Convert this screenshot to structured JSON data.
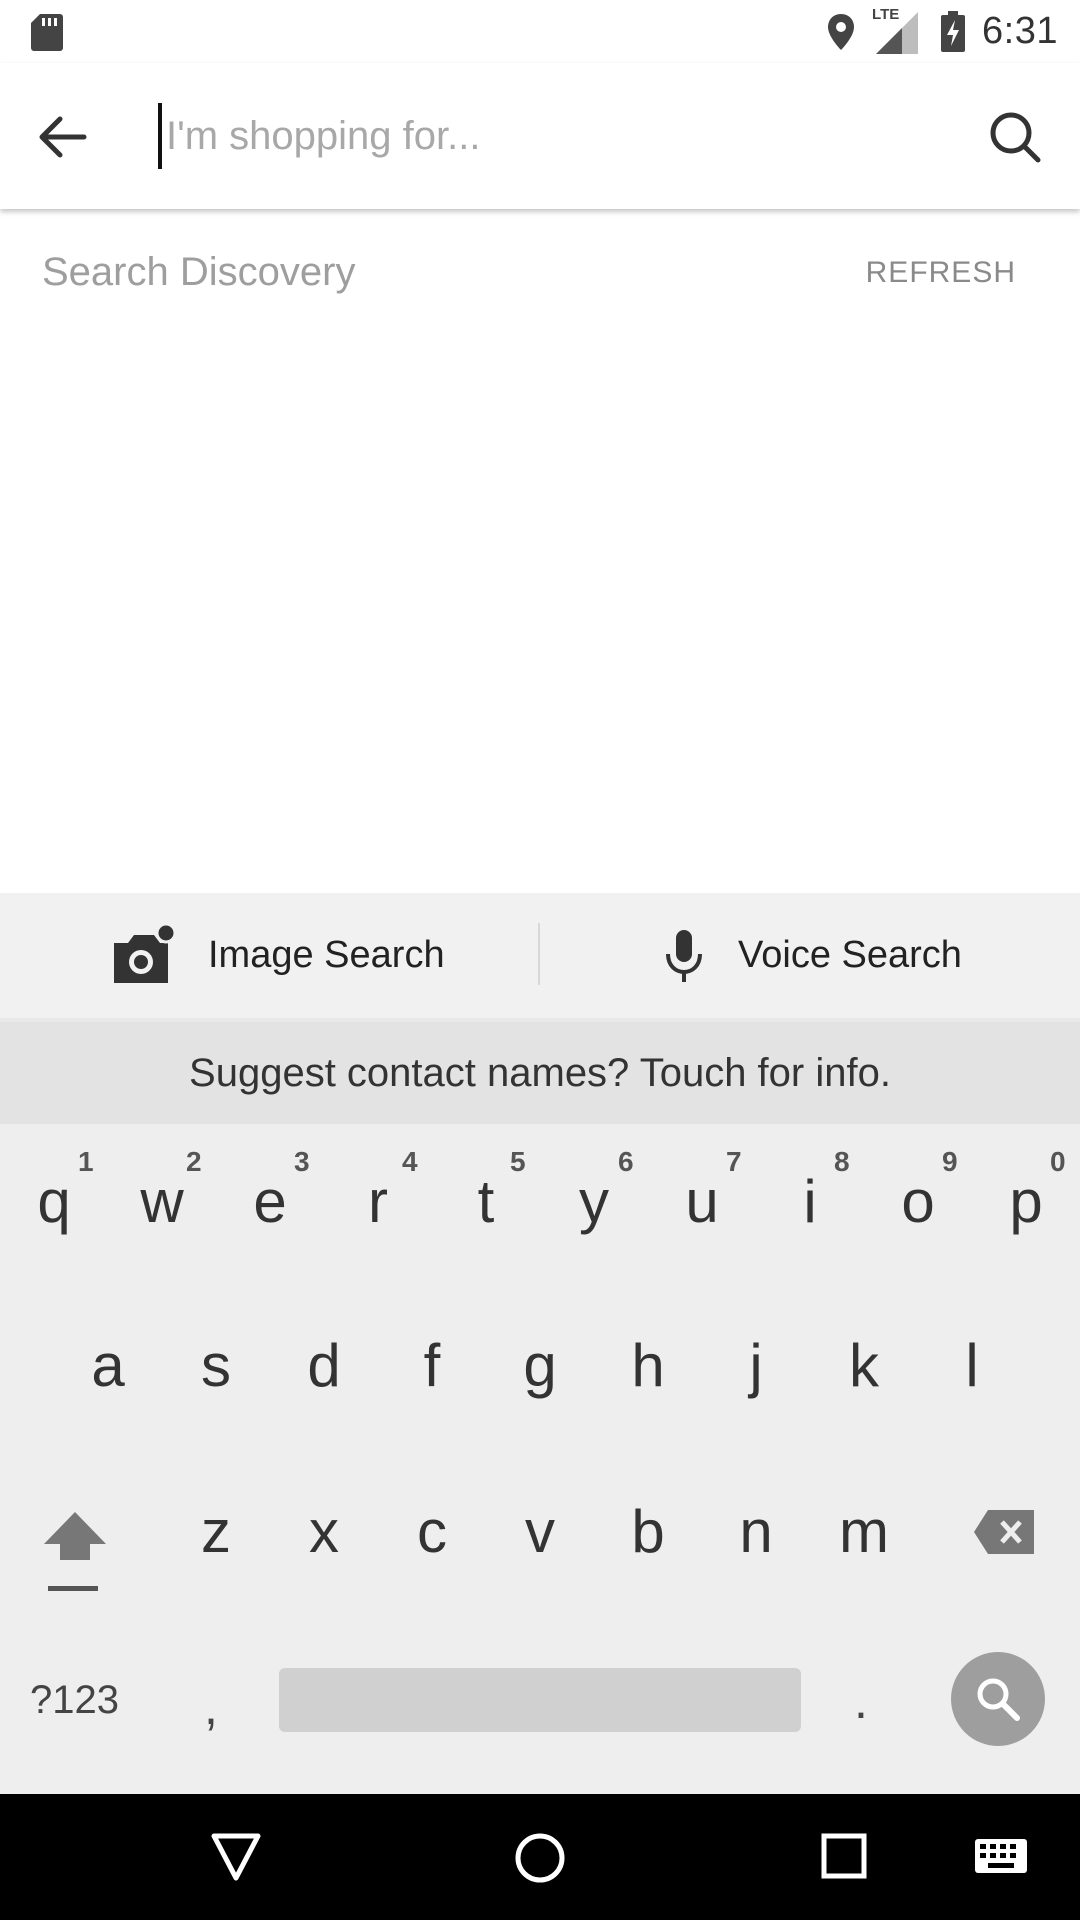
{
  "status_bar": {
    "time": "6:31",
    "network": "LTE",
    "icons": [
      "sd-card-icon",
      "location-icon",
      "signal-icon",
      "battery-charging-icon"
    ]
  },
  "search": {
    "placeholder": "I'm shopping for...",
    "value": ""
  },
  "discovery": {
    "title": "Search Discovery",
    "refresh_label": "REFRESH"
  },
  "tools": {
    "image_search_label": "Image Search",
    "voice_search_label": "Voice Search"
  },
  "keyboard": {
    "suggestion": "Suggest contact names? Touch for info.",
    "row1": [
      "q",
      "w",
      "e",
      "r",
      "t",
      "y",
      "u",
      "i",
      "o",
      "p"
    ],
    "row1_hints": [
      "1",
      "2",
      "3",
      "4",
      "5",
      "6",
      "7",
      "8",
      "9",
      "0"
    ],
    "row2": [
      "a",
      "s",
      "d",
      "f",
      "g",
      "h",
      "j",
      "k",
      "l"
    ],
    "row3": [
      "z",
      "x",
      "c",
      "v",
      "b",
      "n",
      "m"
    ],
    "symbols_label": "?123",
    "comma": ",",
    "period": "."
  },
  "nav_bar": {
    "buttons": [
      "back-icon",
      "home-icon",
      "recents-icon",
      "keyboard-icon"
    ]
  },
  "colors": {
    "keyboard_bg": "#eeeeee",
    "strip_bg": "#e3e3e3",
    "tools_bg": "#f1f1f1",
    "placeholder": "#a8a8a8"
  }
}
